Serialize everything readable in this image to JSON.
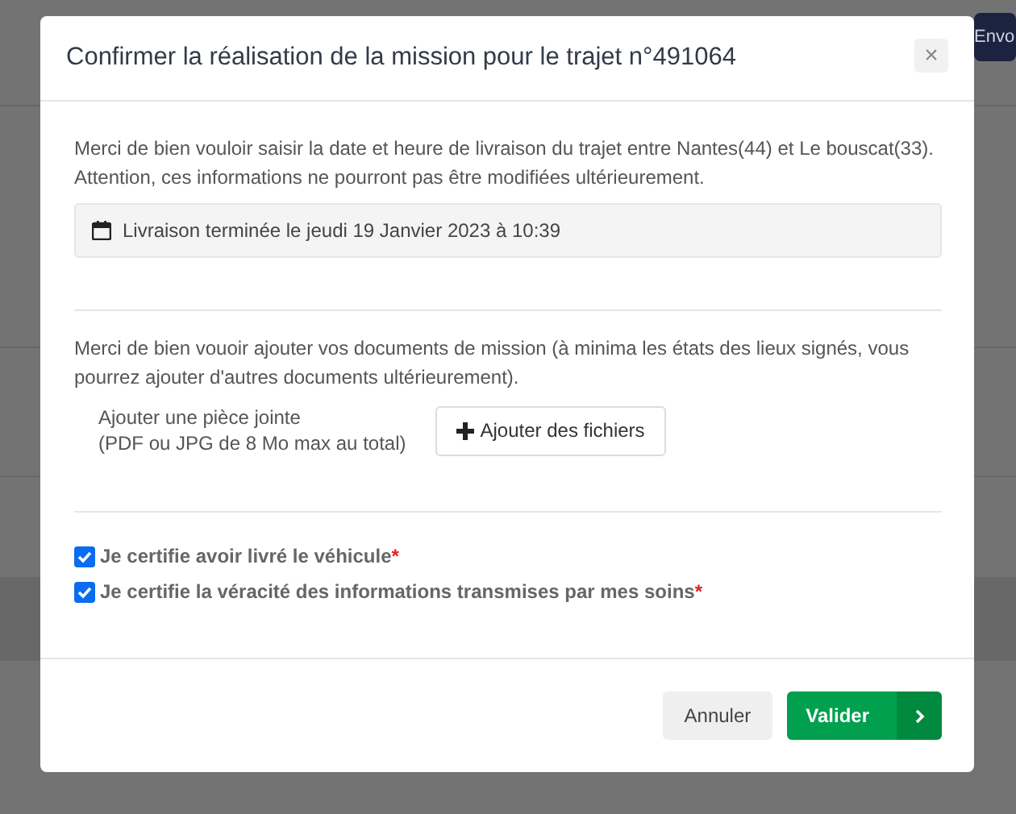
{
  "background": {
    "button_label": "Envo"
  },
  "modal": {
    "title": "Confirmer la réalisation de la mission pour le trajet n°491064",
    "close_label": "×",
    "intro": "Merci de bien vouloir saisir la date et heure de livraison du trajet entre Nantes(44) et Le bouscat(33). Attention, ces informations ne pourront pas être modifiées ultérieurement.",
    "delivery_info": "Livraison terminée le jeudi 19 Janvier 2023 à 10:39",
    "documents_text": "Merci de bien vouoir ajouter vos documents de mission (à minima les états des lieux signés, vous pourrez ajouter d'autres documents ultérieurement).",
    "attachment_label": "Ajouter une pièce jointe",
    "attachment_hint": "(PDF ou JPG de 8 Mo max au total)",
    "add_files_button": "Ajouter des fichiers",
    "certifications": [
      {
        "label": "Je certifie avoir livré le véhicule",
        "required_mark": "*",
        "checked": true
      },
      {
        "label": "Je certifie la véracité des informations transmises par mes soins",
        "required_mark": "*",
        "checked": true
      }
    ],
    "buttons": {
      "cancel": "Annuler",
      "submit": "Valider"
    }
  }
}
